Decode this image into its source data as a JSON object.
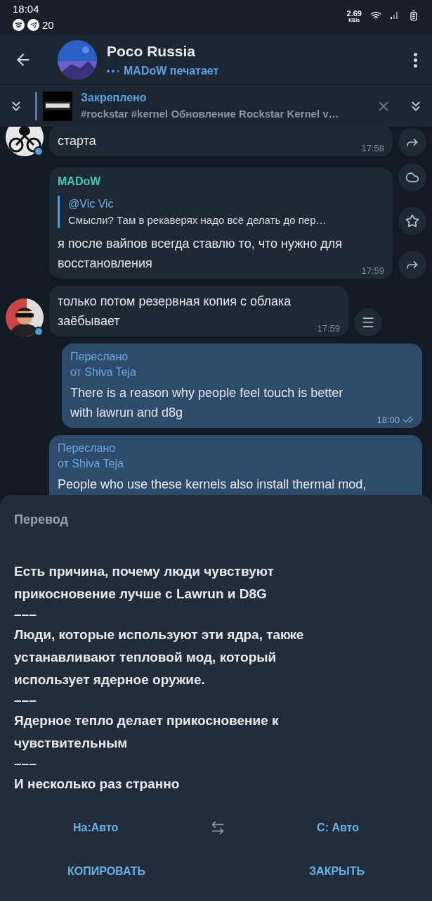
{
  "status_bar": {
    "time": "18:04",
    "notification_count": "20",
    "speed": "2.69",
    "speed_unit": "KB/s"
  },
  "header": {
    "title": "Poco Russia",
    "status": "MADoW печатает"
  },
  "pinned": {
    "label": "Закреплено",
    "text": "#rockstar #kernel Обновление Rockstar Kernel v…"
  },
  "messages": [
    {
      "kind": "incoming",
      "avatar": {
        "kind": "picture"
      },
      "text": "старта",
      "time": "17:58",
      "actions": [
        {
          "kind": "forward"
        }
      ]
    },
    {
      "kind": "incoming",
      "sender": "MADoW",
      "reply": {
        "author": "@Vic Vic",
        "text": "Смысли? Там в рекаверях надо всё делать до пер…"
      },
      "text": "я после вайпов всегда ставлю то, что нужно для восстановления",
      "time": "17:59",
      "actions": [
        {
          "kind": "cloud"
        },
        {
          "kind": "star"
        },
        {
          "kind": "forward"
        }
      ]
    },
    {
      "kind": "incoming",
      "avatar": {
        "kind": "picture"
      },
      "text": "только потом резервная копия с облака заёбывает",
      "time": "17:59",
      "actions": [
        {
          "kind": "menu"
        }
      ]
    },
    {
      "kind": "outgoing",
      "forwarded": {
        "label": "Переслано",
        "from": "от Shiva Teja"
      },
      "text": "There is a reason why people feel touch is better with lawrun and d8g",
      "time": "18:00",
      "read": true
    },
    {
      "kind": "outgoing",
      "forwarded": {
        "label": "Переслано",
        "from": "от Shiva Teja"
      },
      "text": "People who use these kernels also install thermal mod,"
    }
  ],
  "translation": {
    "title": "Перевод",
    "lines": [
      {
        "kind": "text",
        "text": "Есть причина, почему люди чувствуют прикосновение лучше с Lawrun и D8G"
      },
      {
        "kind": "separator",
        "text": "–––"
      },
      {
        "kind": "text",
        "text": "Люди, которые используют эти ядра, также устанавливают тепловой мод, который использует ядерное оружие."
      },
      {
        "kind": "separator",
        "text": "–––"
      },
      {
        "kind": "text",
        "text": "Ядерное тепло делает прикосновение к чувствительным"
      },
      {
        "kind": "separator",
        "text": "–––"
      },
      {
        "kind": "text",
        "text": "И несколько раз странно"
      }
    ],
    "to_language": "На:Авто",
    "from_language": "С: Авто",
    "buttons": [
      "КОПИРОВАТЬ",
      "ЗАКРЫТЬ"
    ]
  }
}
